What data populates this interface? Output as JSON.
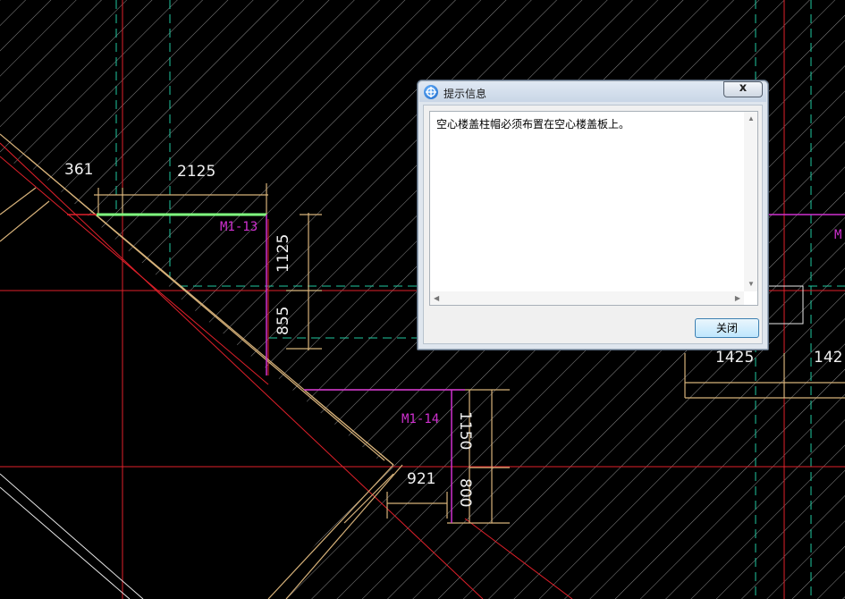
{
  "drawing": {
    "dimensions": [
      "361",
      "2125",
      "1125",
      "855",
      "1150",
      "800",
      "921",
      "1425",
      "142"
    ],
    "door_tags": [
      "M1-13",
      "M1-14",
      "M"
    ],
    "colors": {
      "background": "#000000",
      "hatch": "#9a9a9a",
      "wall_red": "#e0202a",
      "axis_cyan": "#20c8a0",
      "dim_tan": "#d7b27a",
      "door_magenta": "#d030d0",
      "highlight_green": "#80ff80"
    }
  },
  "dialog": {
    "title": "提示信息",
    "close_glyph": "x",
    "message": "空心楼盖柱帽必须布置在空心楼盖板上。",
    "close_button": "关闭"
  }
}
